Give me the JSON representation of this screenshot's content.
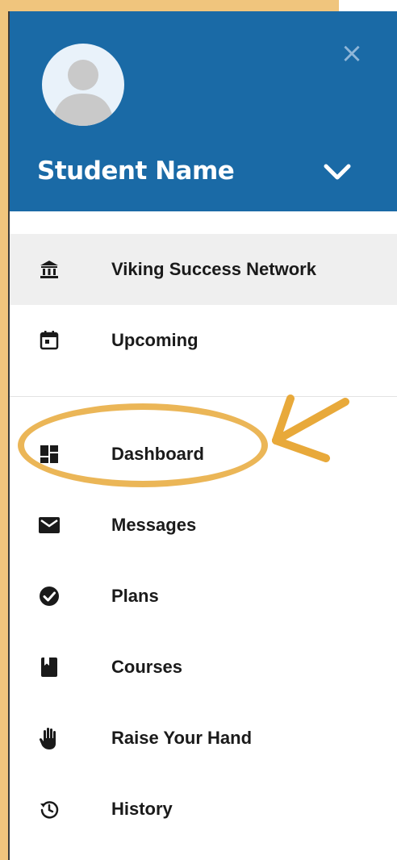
{
  "header": {
    "student_name": "Student Name",
    "close_symbol": "×",
    "header_color": "#1a6aa6"
  },
  "sections": {
    "top": [
      {
        "label": "Viking Success Network",
        "icon": "bank-icon",
        "active": true
      },
      {
        "label": "Upcoming",
        "icon": "calendar-icon",
        "active": false
      }
    ],
    "main": [
      {
        "label": "Dashboard",
        "icon": "dashboard-icon"
      },
      {
        "label": "Messages",
        "icon": "mail-icon"
      },
      {
        "label": "Plans",
        "icon": "check-circle-icon"
      },
      {
        "label": "Courses",
        "icon": "book-icon"
      },
      {
        "label": "Raise Your Hand",
        "icon": "hand-icon"
      },
      {
        "label": "History",
        "icon": "history-icon"
      }
    ]
  },
  "annotation": {
    "highlight_color": "#e8a93a"
  }
}
